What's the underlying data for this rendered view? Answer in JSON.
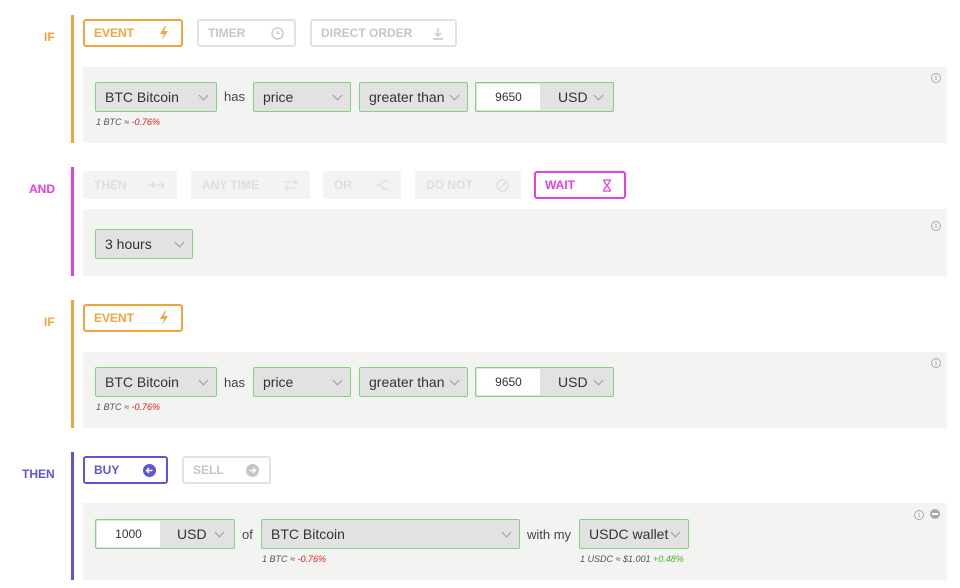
{
  "blocks": [
    {
      "label": "IF",
      "tabs": {
        "event": "EVENT",
        "timer": "TIMER",
        "direct_order": "DIRECT ORDER"
      },
      "asset": "BTC Bitcoin",
      "has": "has",
      "field": "price",
      "comparator": "greater than",
      "amount": "9650",
      "currency": "USD",
      "rate_prefix": "1 BTC ≈",
      "rate_change": "-0.76%"
    },
    {
      "label": "AND",
      "tabs": {
        "then": "THEN",
        "any_time": "ANY TIME",
        "or": "OR",
        "do_not": "DO NOT",
        "wait": "WAIT"
      },
      "duration": "3 hours"
    },
    {
      "label": "IF",
      "tabs": {
        "event": "EVENT"
      },
      "asset": "BTC Bitcoin",
      "has": "has",
      "field": "price",
      "comparator": "greater than",
      "amount": "9650",
      "currency": "USD",
      "rate_prefix": "1 BTC ≈",
      "rate_change": "-0.76%"
    },
    {
      "label": "THEN",
      "tabs": {
        "buy": "BUY",
        "sell": "SELL"
      },
      "amount": "1000",
      "currency": "USD",
      "of": "of",
      "asset": "BTC Bitcoin",
      "with_my": "with my",
      "wallet": "USDC wallet",
      "rate_prefix": "1 BTC ≈",
      "rate_change": "-0.76%",
      "wallet_rate_prefix": "1 USDC ≈ $1.001",
      "wallet_rate_change": "+0.48%"
    }
  ],
  "info_icon_glyph": "i",
  "colors": {
    "if": "#f0a53a",
    "and": "#e43ee4",
    "then": "#5b57d8",
    "panel": "#f3f3f1",
    "control_border": "#7fd27f",
    "negative": "#e0211b",
    "positive": "#4caf2a"
  },
  "icons": {
    "event": "lightning-icon",
    "timer": "clock-icon",
    "direct_order": "download-arrow-icon",
    "then": "double-arrow-icon",
    "any_time": "swap-arrows-icon",
    "or": "split-icon",
    "do_not": "prohibited-icon",
    "wait": "hourglass-icon",
    "buy": "arrow-circle-left-icon",
    "sell": "arrow-circle-right-icon",
    "info": "info-icon",
    "remove": "minus-circle-icon"
  }
}
